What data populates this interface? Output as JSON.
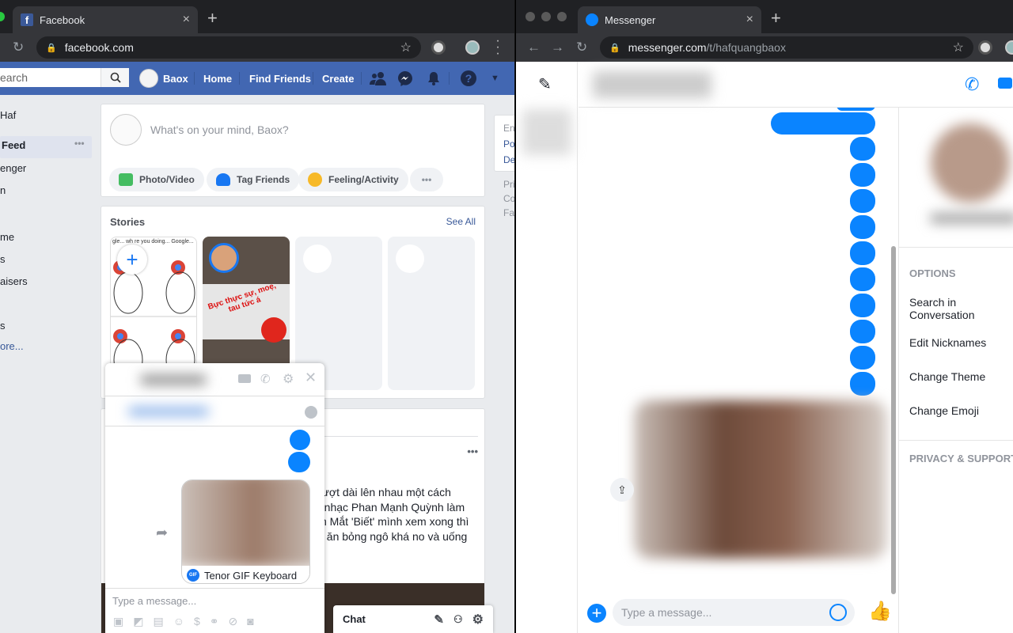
{
  "left_window": {
    "tab": {
      "title": "Facebook",
      "favicon": "facebook-icon",
      "close": "×"
    },
    "new_tab": "+",
    "address": "facebook.com",
    "fb_header": {
      "search_placeholder": "earch",
      "profile_name": "Baox",
      "nav": [
        "Home",
        "Find Friends",
        "Create"
      ]
    },
    "left_nav": [
      "Haf",
      "Feed",
      "enger",
      "n",
      "me",
      "s",
      "aisers",
      "s",
      "ore..."
    ],
    "composer": {
      "placeholder": "What's on your mind, Baox?",
      "actions": [
        "Photo/Video",
        "Tag Friends",
        "Feeling/Activity"
      ],
      "more": "•••"
    },
    "stories": {
      "title": "Stories",
      "see_all": "See All",
      "caption": "Bực thực sự, moẹ, tau tức á",
      "chrome_meme_text": "gle... wh   re you doing... Google..."
    },
    "right_col": [
      "En",
      "Po",
      "De",
      "Pri",
      "Co",
      "Fa"
    ],
    "post": {
      "more": "•••",
      "lines": [
        "trượt dài lên nhau một cách",
        "e nhạc Phan Mạnh Quỳnh làm",
        "im Mắt 'Biết' mình xem xong thì",
        "vì ăn bỏng ngô khá no và uống"
      ]
    },
    "chat_popup": {
      "gif_source": "Tenor GIF Keyboard",
      "gif_badge": "GIF",
      "input_placeholder": "Type a message...",
      "toolbar_icons": [
        "photo-icon",
        "sticker-icon",
        "gif-icon",
        "emoji-icon",
        "money-icon",
        "link-icon",
        "attach-icon",
        "camera-icon"
      ]
    },
    "chat_bar": {
      "label": "Chat"
    }
  },
  "right_window": {
    "tab": {
      "title": "Messenger",
      "favicon": "messenger-icon",
      "close": "×"
    },
    "new_tab": "+",
    "address_host": "messenger.com",
    "address_path": "/t/hafquangbaox",
    "options": {
      "header": "OPTIONS",
      "items": [
        "Search in Conversation",
        "Edit Nicknames",
        "Change Theme",
        "Change Emoji"
      ],
      "privacy_header": "PRIVACY & SUPPORT"
    },
    "composer_placeholder": "Type a message..."
  },
  "colors": {
    "fb_blue": "#4267b2",
    "messenger_blue": "#0a84ff",
    "chrome_dark": "#202124"
  }
}
